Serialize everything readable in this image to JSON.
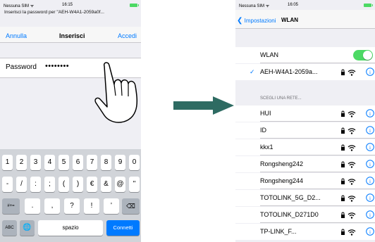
{
  "left_screen": {
    "status": {
      "carrier": "Nessuna SIM",
      "time": "16:15"
    },
    "prompt": "Inserisci la password per \"AEH-W4A1-2059a0f...",
    "nav": {
      "cancel": "Annulla",
      "title": "Inserisci",
      "join": "Accedi"
    },
    "password": {
      "label": "Password",
      "value": "••••••••"
    },
    "keyboard": {
      "row1": [
        "1",
        "2",
        "3",
        "4",
        "5",
        "6",
        "7",
        "8",
        "9",
        "0"
      ],
      "row2": [
        "-",
        "/",
        ":",
        ";",
        "(",
        ")",
        "€",
        "&",
        "@",
        "\""
      ],
      "row3_mode": "#+=",
      "row3": [
        ".",
        ",",
        "?",
        "!",
        "'"
      ],
      "abc": "ABC",
      "space": "spazio",
      "connect": "Connetti"
    }
  },
  "right_screen": {
    "status": {
      "carrier": "Nessuna SIM",
      "time": "16:05"
    },
    "nav": {
      "back": "Impostazioni",
      "title": "WLAN"
    },
    "wlan_label": "WLAN",
    "wlan_on": true,
    "connected_network": "AEH-W4A1-2059a...",
    "section_header": "SCEGLI UNA RETE...",
    "networks": [
      "HUI",
      "ID",
      "kkx1",
      "Rongsheng242",
      "Rongsheng244",
      "TOTOLINK_5G_D2...",
      "TOTOLINK_D271D0",
      "TP-LINK_F..."
    ]
  },
  "colors": {
    "accent": "#007aff",
    "toggle_on": "#4cd964",
    "arrow": "#2e6b62"
  },
  "icons": [
    "wifi-icon",
    "lock-icon",
    "info-icon",
    "hand-pointer-icon",
    "backspace-icon",
    "globe-icon",
    "checkmark-icon",
    "arrow-right-icon"
  ]
}
